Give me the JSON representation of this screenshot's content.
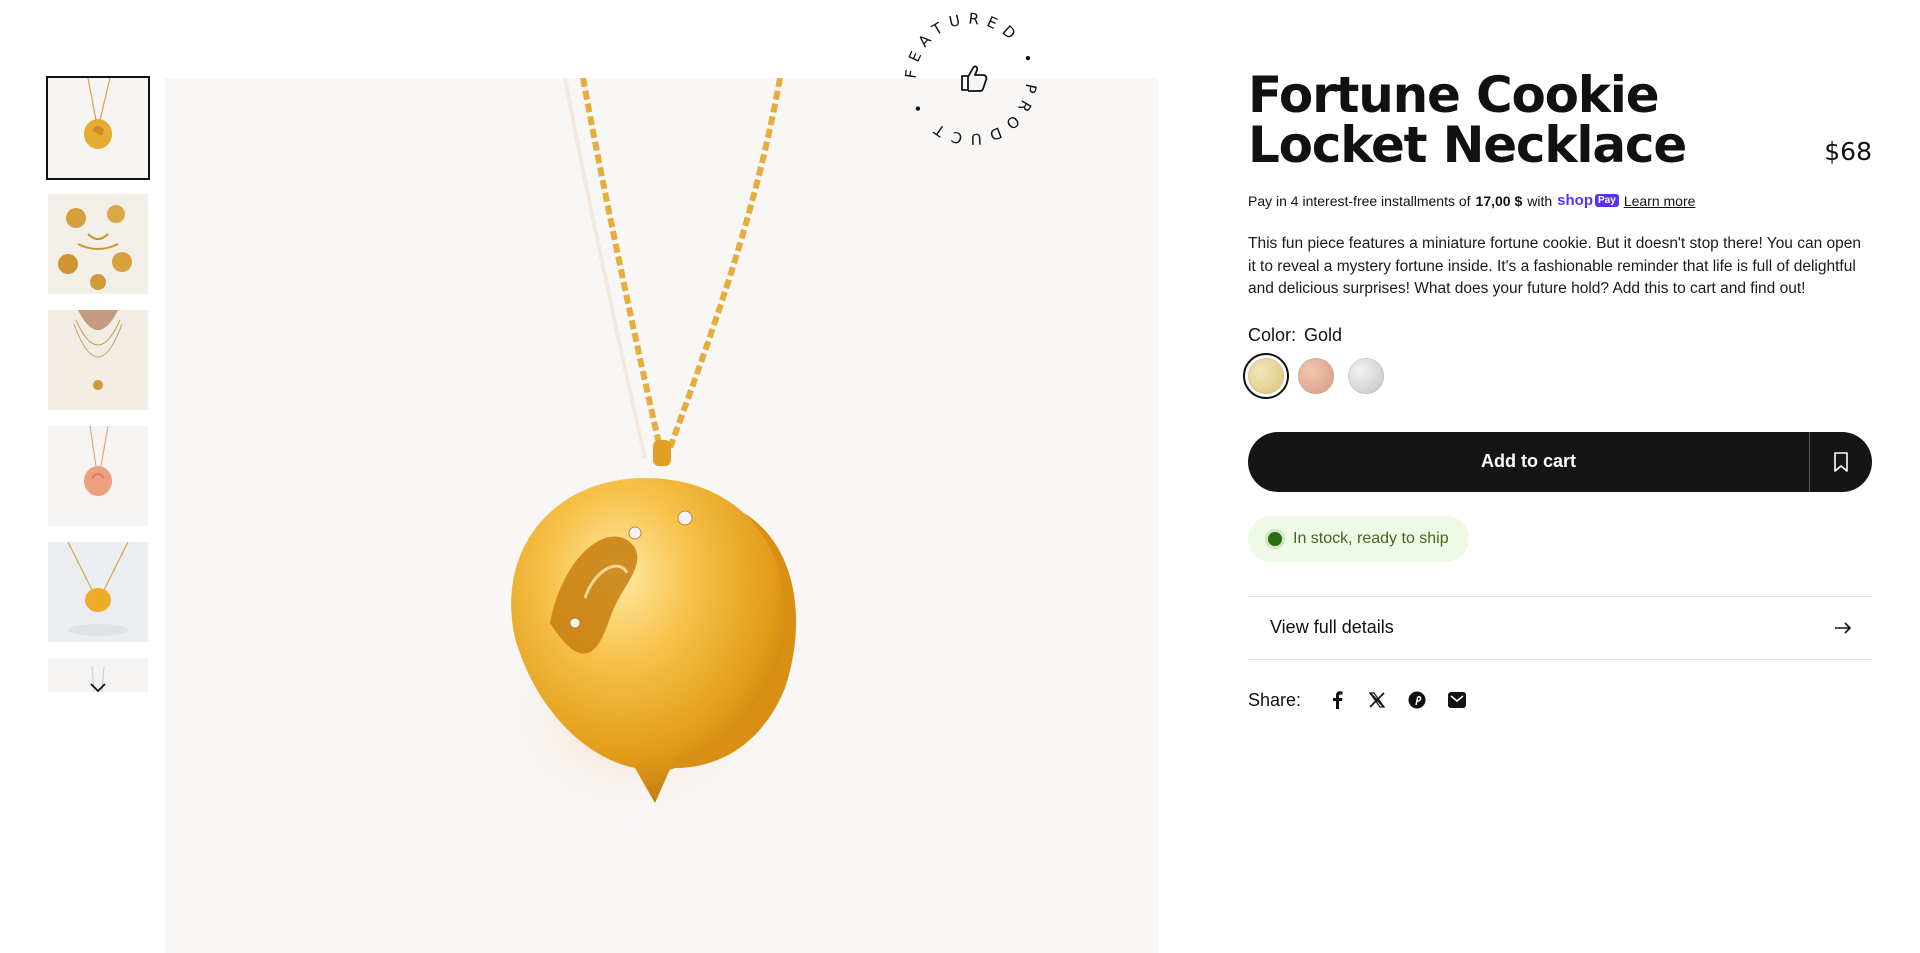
{
  "product": {
    "title": "Fortune Cookie Locket Necklace",
    "price": "$68",
    "installments": {
      "prefix": "Pay in 4 interest-free installments of",
      "amount": "17,00 $",
      "with": "with",
      "provider": "shop",
      "provider_badge": "Pay",
      "learn_more": "Learn more"
    },
    "description": "This fun piece features a miniature fortune cookie. But it doesn't stop there! You can open it to reveal a mystery fortune inside. It's a fashionable reminder that life is full of delightful and delicious surprises! What does your future hold? Add this to cart and find out!",
    "color_label": "Color:",
    "color_value": "Gold",
    "swatches": [
      {
        "name": "Gold",
        "color": "#e3d08f",
        "selected": true
      },
      {
        "name": "Rose Gold",
        "color": "#e1a98f",
        "selected": false
      },
      {
        "name": "Silver",
        "color": "#d6d6d6",
        "selected": false
      }
    ],
    "add_to_cart": "Add to cart",
    "stock": "In stock, ready to ship",
    "view_details": "View full details",
    "share_label": "Share:"
  },
  "badge": {
    "text": "FEATURED • PRODUCT •"
  },
  "gallery": {
    "thumbnails": [
      "gold pendant",
      "pendants arranged",
      "model wearing",
      "rose gold pendant",
      "pendant on surface",
      "partial"
    ],
    "active_index": 0
  },
  "colors": {
    "accent_dark": "#151515",
    "stock_bg": "#eef9e6",
    "stock_text": "#3d6b1e",
    "shoppay": "#5a31f4"
  }
}
